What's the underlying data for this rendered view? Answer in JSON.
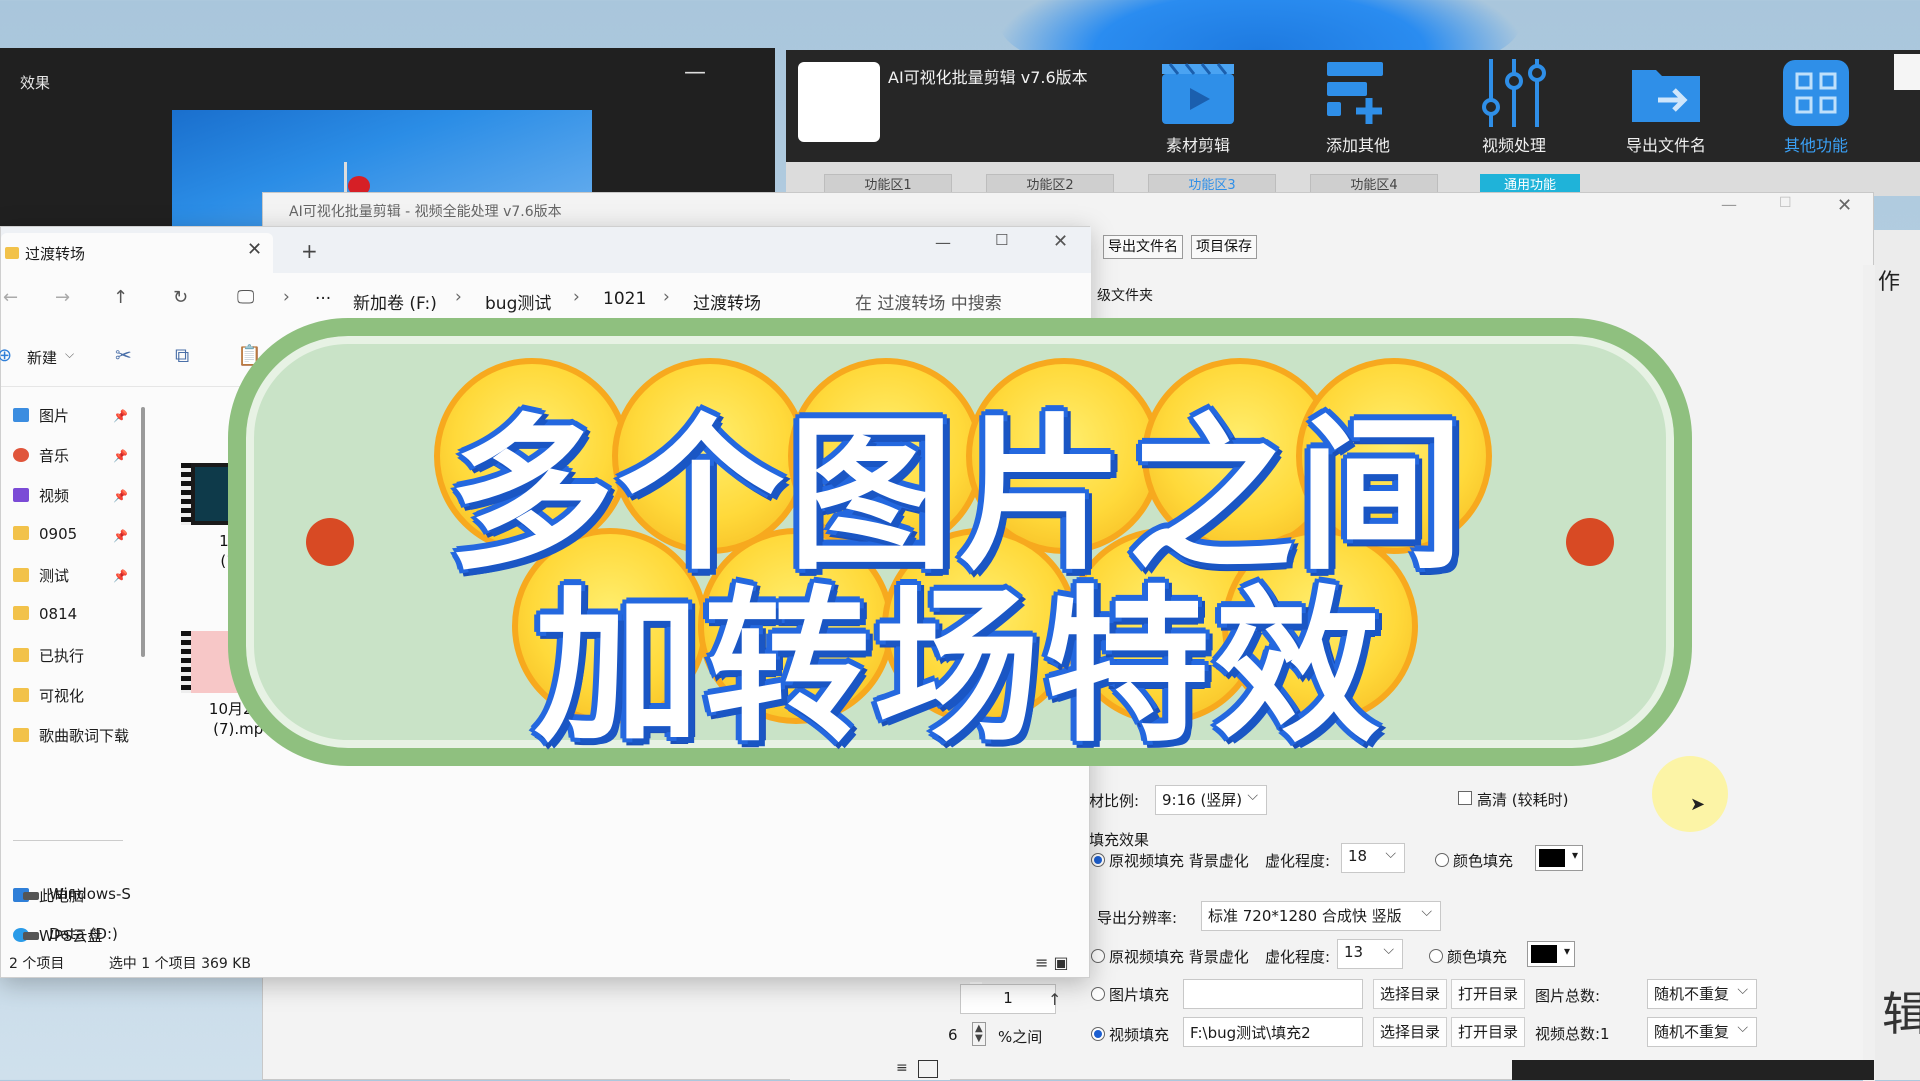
{
  "effects": {
    "title": "效果",
    "min": "—"
  },
  "app": {
    "title": "AI可视化批量剪辑 v7.6版本",
    "tools": [
      {
        "label": "素材剪辑",
        "icon": "clapperboard-icon"
      },
      {
        "label": "添加其他",
        "icon": "add-list-icon"
      },
      {
        "label": "视频处理",
        "icon": "sliders-icon"
      },
      {
        "label": "导出文件名",
        "icon": "export-folder-icon"
      },
      {
        "label": "其他功能",
        "icon": "grid-icon"
      }
    ],
    "func_tabs": [
      "功能区1",
      "功能区2",
      "功能区3",
      "功能区4",
      "通用功能"
    ]
  },
  "video_window": {
    "title": "AI可视化批量剪辑 - 视频全能处理 v7.6版本",
    "subtabs": [
      "导出文件名",
      "项目保存"
    ],
    "folder_label": "级文件夹",
    "ratio_label": "材比例:",
    "ratio_value": "9:16 (竖屏)",
    "hd_label": "高清 (较耗时)",
    "fill_title": "填充效果",
    "fill1_label": "原视频填充 背景虚化",
    "blur_label": "虚化程度:",
    "blur1_value": "18",
    "color_fill_label": "颜色填充",
    "res_label": "导出分辨率:",
    "res_value": "标准 720*1280 合成快 竖版",
    "fill2_label": "原视频填充 背景虚化",
    "blur2_value": "13",
    "image_fill_label": "图片填充",
    "video_fill_label": "视频填充",
    "video_fill_path": "F:\\bug测试\\填充2",
    "select_dir": "选择目录",
    "open_dir": "打开目录",
    "image_count_label": "图片总数:",
    "video_count_label": "视频总数:1",
    "random_option": "随机不重复",
    "stepper_value": "1",
    "percent_value": "6",
    "percent_label": "%之间"
  },
  "edge": {
    "char_top": "作",
    "char_bottom": "辑"
  },
  "explorer": {
    "tab_title": "过渡转场",
    "breadcrumbs": [
      "新加卷 (F:)",
      "bug测试",
      "1021",
      "过渡转场"
    ],
    "ellipsis": "···",
    "search_placeholder": "在 过渡转场 中搜索",
    "new_label": "新建",
    "sidebar": [
      {
        "label": "图片",
        "color": "#3b8de0",
        "pinned": true
      },
      {
        "label": "音乐",
        "color": "#e0553b",
        "pinned": true
      },
      {
        "label": "视频",
        "color": "#7b4bd6",
        "pinned": true
      },
      {
        "label": "0905",
        "color": "#f2c24a",
        "pinned": true
      },
      {
        "label": "测试",
        "color": "#f2c24a",
        "pinned": true
      },
      {
        "label": "0814",
        "color": "#f2c24a",
        "pinned": false
      },
      {
        "label": "已执行",
        "color": "#f2c24a",
        "pinned": false
      },
      {
        "label": "可视化",
        "color": "#f2c24a",
        "pinned": false
      },
      {
        "label": "歌曲歌词下载",
        "color": "#f2c24a",
        "pinned": false
      }
    ],
    "drives": [
      {
        "label": "此电脑",
        "color": "#2f7fd8"
      },
      {
        "label": "WPS云盘",
        "color": "#2a9be8"
      },
      {
        "label": "Windows-S",
        "color": "#555555"
      },
      {
        "label": "Data (D:)",
        "color": "#555555"
      }
    ],
    "files": [
      {
        "name_line1": "10,",
        "name_line2": "(1)"
      },
      {
        "name_line1": "10月21日",
        "name_line2": "(7).mp4"
      }
    ],
    "status": {
      "count": "2 个项目",
      "selected": "选中 1 个项目  369 KB"
    }
  },
  "banner": {
    "line1": "多个图片之间",
    "line2": "加转场特效"
  }
}
